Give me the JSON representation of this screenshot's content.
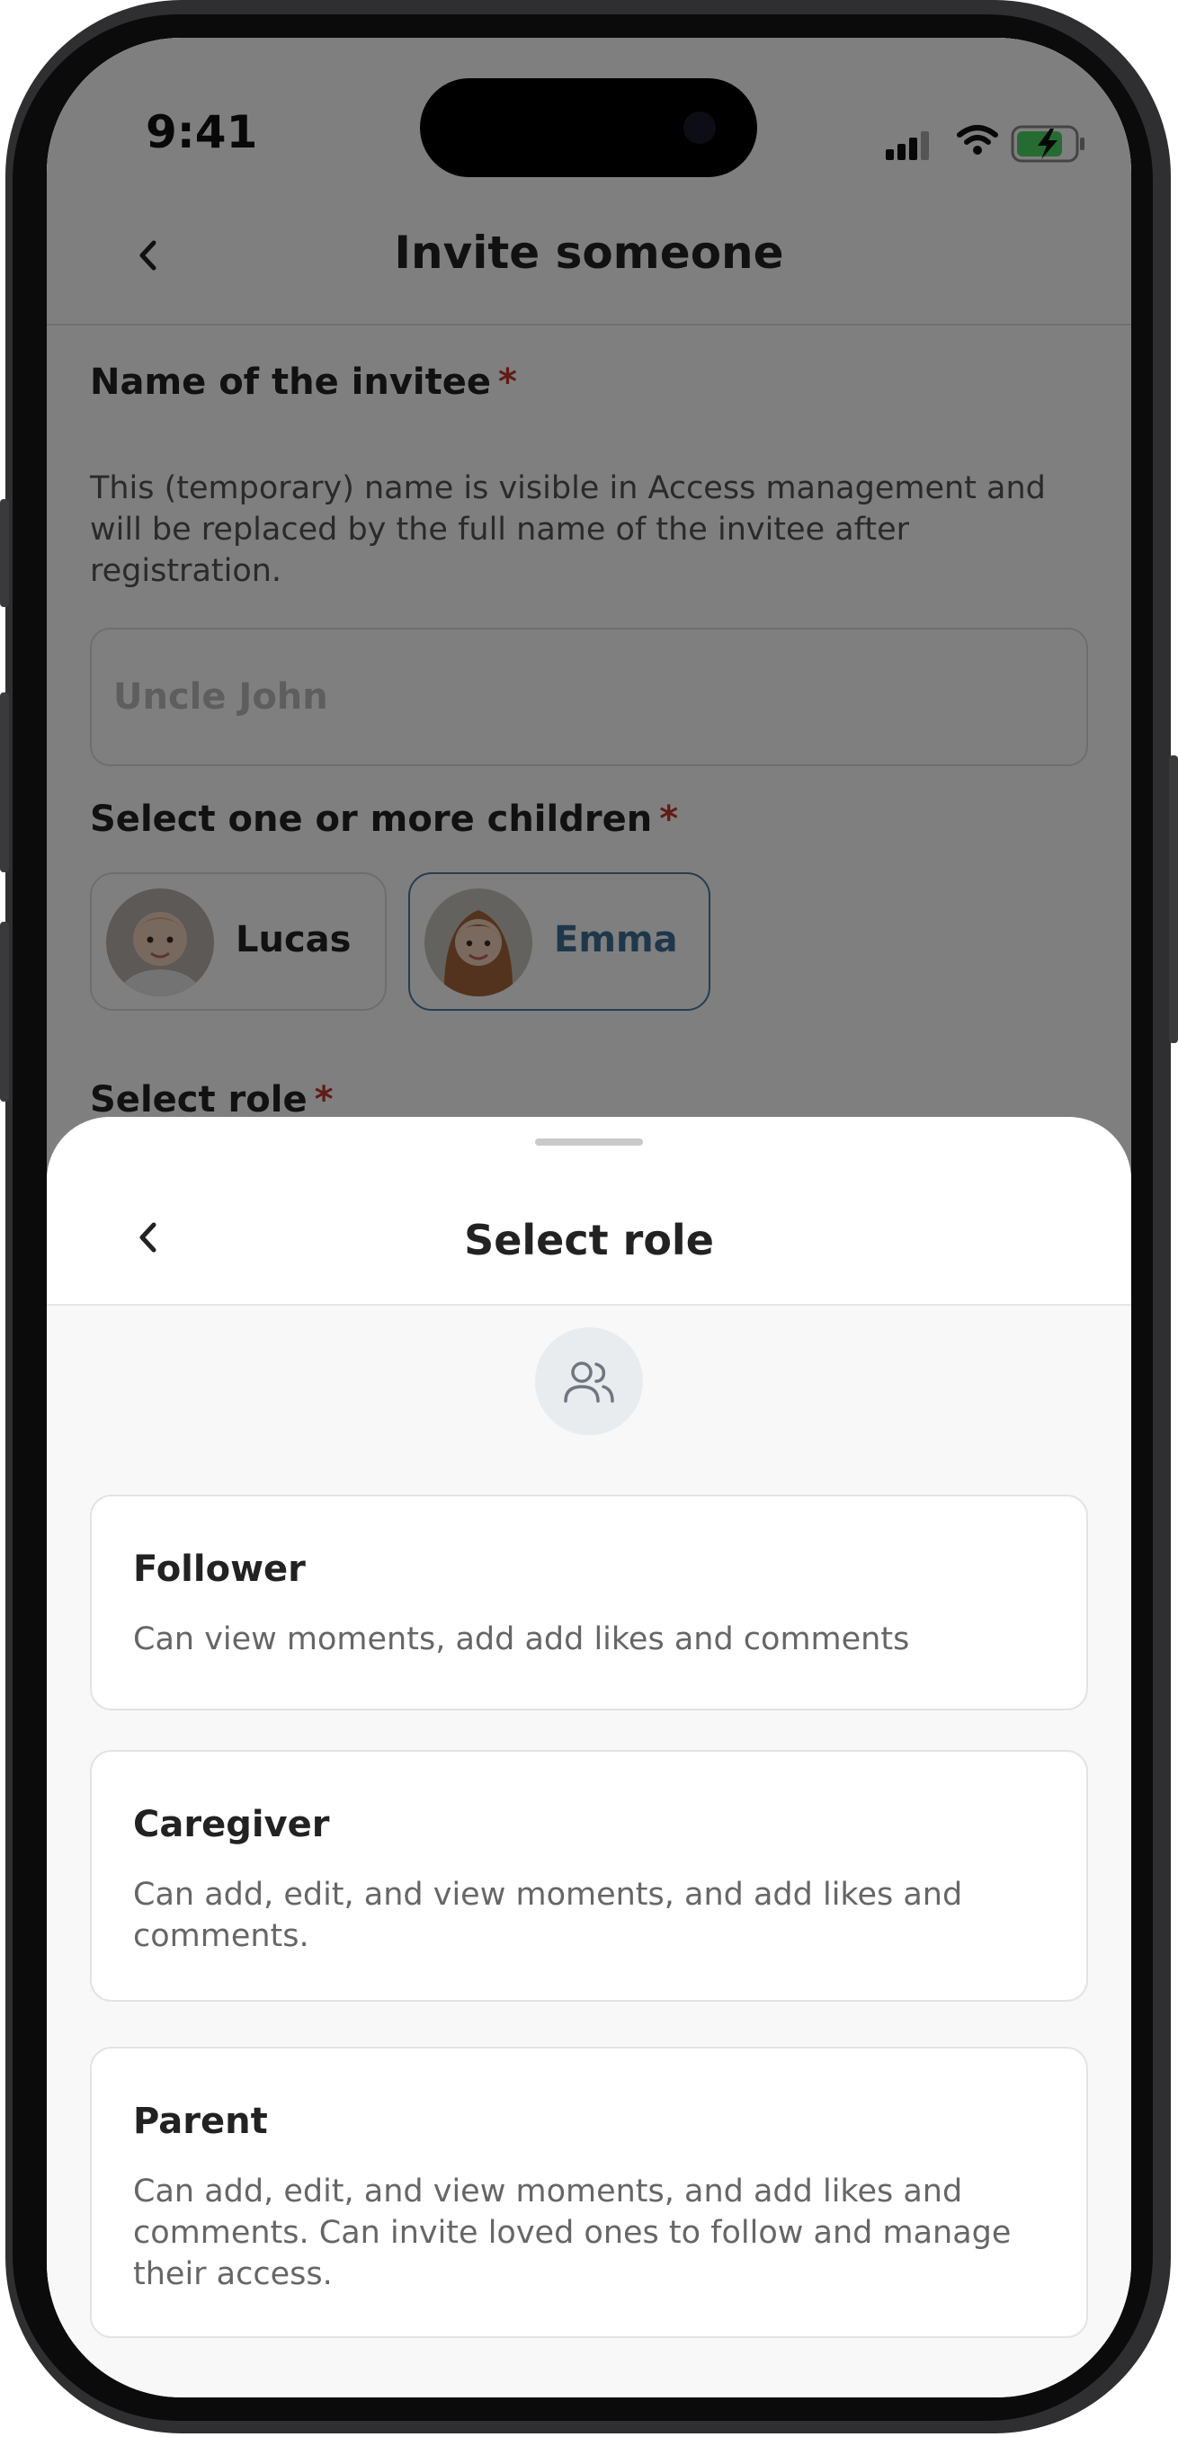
{
  "status_bar": {
    "time": "9:41"
  },
  "header": {
    "title": "Invite someone"
  },
  "form": {
    "name_label": "Name of the invitee",
    "required_mark": "*",
    "name_help": "This (temporary) name is visible in Access management and will be replaced by the full name of the invitee after registration.",
    "name_value": "",
    "name_placeholder": "Uncle John",
    "children_label": "Select one or more children",
    "children": [
      {
        "name": "Lucas",
        "selected": false
      },
      {
        "name": "Emma",
        "selected": true
      }
    ],
    "role_label": "Select role"
  },
  "sheet": {
    "title": "Select role",
    "icon": "users-icon",
    "roles": [
      {
        "title": "Follower",
        "description": "Can view moments, add add likes and comments"
      },
      {
        "title": "Caregiver",
        "description": "Can add, edit, and view moments, and add likes and comments."
      },
      {
        "title": "Parent",
        "description": "Can add, edit, and view moments, and add likes and comments. Can invite loved ones to follow and manage their access."
      }
    ]
  },
  "colors": {
    "accent": "#4a7ba3",
    "required": "#c0392b",
    "overlay": "rgba(0,0,0,0.5)",
    "battery": "#4cd964"
  }
}
